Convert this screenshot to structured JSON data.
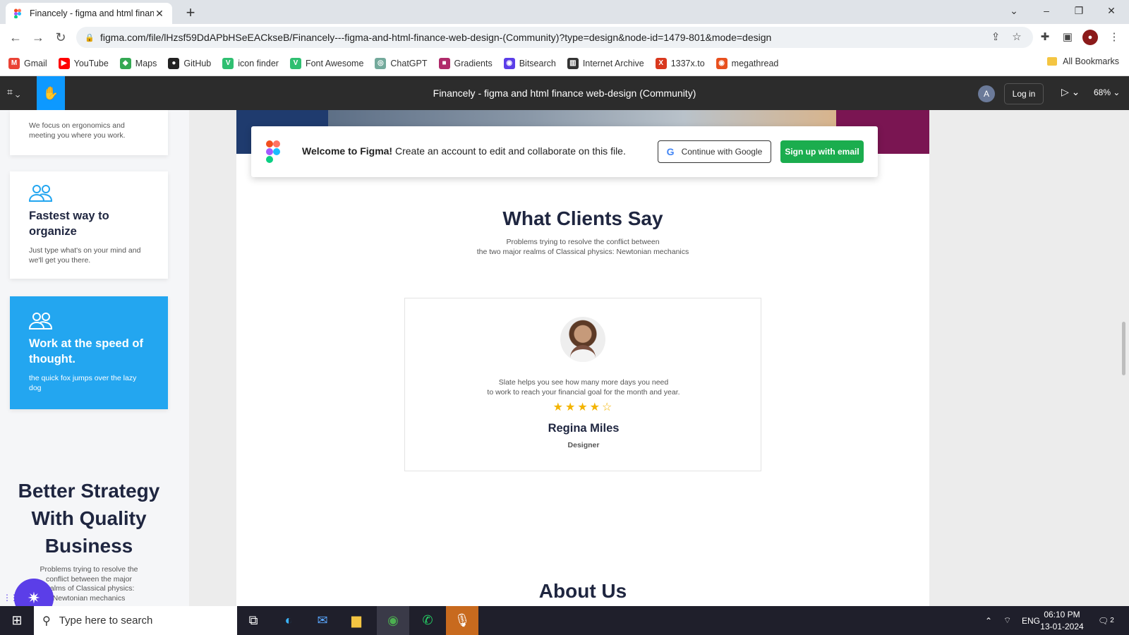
{
  "browser": {
    "tab_title": "Financely - figma and html finan",
    "url": "figma.com/file/lHzsf59DdAPbHSeEACkseB/Financely---figma-and-html-finance-web-design-(Community)?type=design&node-id=1479-801&mode=design",
    "bookmarks": [
      {
        "label": "Gmail",
        "color": "#ea4335",
        "glyph": "M"
      },
      {
        "label": "YouTube",
        "color": "#ff0000",
        "glyph": "▶"
      },
      {
        "label": "Maps",
        "color": "#34a853",
        "glyph": "◆"
      },
      {
        "label": "GitHub",
        "color": "#222222",
        "glyph": "●"
      },
      {
        "label": "icon finder",
        "color": "#2fbf71",
        "glyph": "V"
      },
      {
        "label": "Font Awesome",
        "color": "#2fbf71",
        "glyph": "V"
      },
      {
        "label": "ChatGPT",
        "color": "#74aa9c",
        "glyph": "◎"
      },
      {
        "label": "Gradients",
        "color": "#b02a6a",
        "glyph": "■"
      },
      {
        "label": "Bitsearch",
        "color": "#5b3ee8",
        "glyph": "◉"
      },
      {
        "label": "Internet Archive",
        "color": "#333333",
        "glyph": "▥"
      },
      {
        "label": "1337x.to",
        "color": "#d9381e",
        "glyph": "X"
      },
      {
        "label": "megathread",
        "color": "#e8501e",
        "glyph": "◉"
      }
    ],
    "all_bookmarks": "All Bookmarks"
  },
  "figma": {
    "file_title": "Financely - figma and html finance web-design (Community)",
    "avatar_letter": "A",
    "login_label": "Log in",
    "zoom": "68%",
    "banner_welcome": "Welcome to Figma!",
    "banner_text": "Create an account to edit and collaborate on this file.",
    "google_btn": "Continue with Google",
    "email_btn": "Sign up with email"
  },
  "left_frame": {
    "card1_text": "We focus on ergonomics and meeting you where you work.",
    "card2_title": "Fastest way to organize",
    "card2_text": "Just type what's on your mind and we'll get you there.",
    "card3_title": "Work at the speed of thought.",
    "card3_text": "the quick fox jumps over the lazy dog",
    "strategy_title": "Better Strategy With Quality Business",
    "strategy_text": "Problems trying to resolve the conflict between the major realms of Classical physics: Newtonian mechanics"
  },
  "main_frame": {
    "clients_title": "What Clients Say",
    "clients_line1": "Problems trying to resolve the conflict between",
    "clients_line2": "the two major realms of Classical physics: Newtonian mechanics",
    "quote_line1": "Slate helps you see how many more days you need",
    "quote_line2": "to work to reach your financial goal for the month and year.",
    "rating": 4,
    "rating_max": 5,
    "name": "Regina Miles",
    "role": "Designer",
    "about_title": "About Us"
  },
  "taskbar": {
    "search_placeholder": "Type here to search",
    "lang": "ENG",
    "time": "06:10 PM",
    "date": "13-01-2024",
    "notifications": "2"
  }
}
